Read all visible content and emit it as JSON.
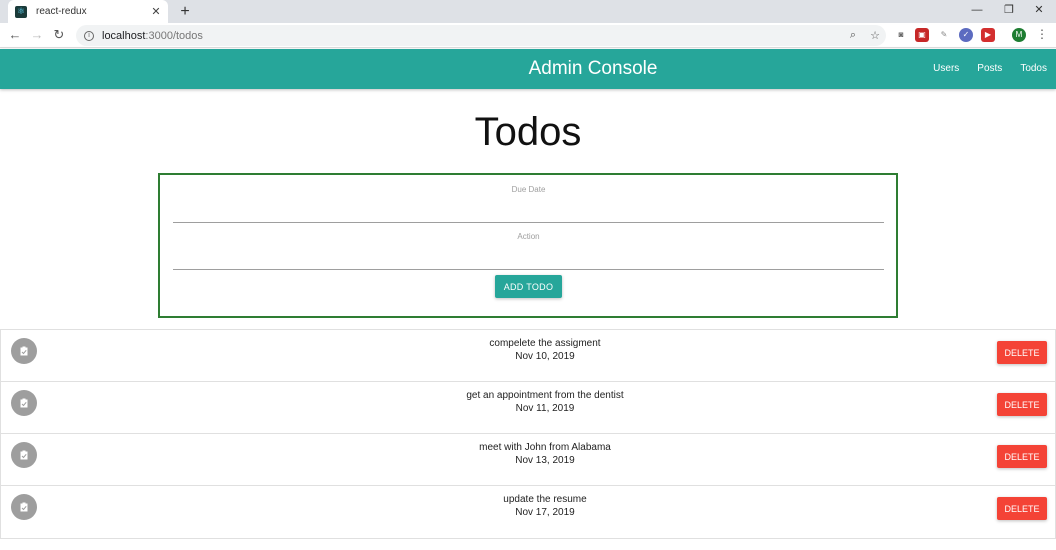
{
  "browser": {
    "tab_title": "react-redux",
    "new_tab": "+",
    "url_host": "localhost",
    "url_path": ":3000/todos",
    "window_controls": {
      "minimize": "—",
      "restore": "❐",
      "close": "✕"
    },
    "avatar_letter": "M"
  },
  "app": {
    "brand": "Admin Console",
    "nav": [
      {
        "label": "Users"
      },
      {
        "label": "Posts"
      },
      {
        "label": "Todos"
      }
    ],
    "accent_color": "#26a69a"
  },
  "page": {
    "title": "Todos"
  },
  "form": {
    "due_date_label": "Due Date",
    "due_date_value": "",
    "action_label": "Action",
    "action_value": "",
    "submit_label": "ADD TODO",
    "border_color": "#2e7d32"
  },
  "todos": [
    {
      "action": "compelete the assigment",
      "date": "Nov 10, 2019",
      "delete_label": "DELETE"
    },
    {
      "action": "get an appointment from the dentist",
      "date": "Nov 11, 2019",
      "delete_label": "DELETE"
    },
    {
      "action": "meet with John from Alabama",
      "date": "Nov 13, 2019",
      "delete_label": "DELETE"
    },
    {
      "action": "update the resume",
      "date": "Nov 17, 2019",
      "delete_label": "DELETE"
    }
  ],
  "delete_color": "#f44336"
}
